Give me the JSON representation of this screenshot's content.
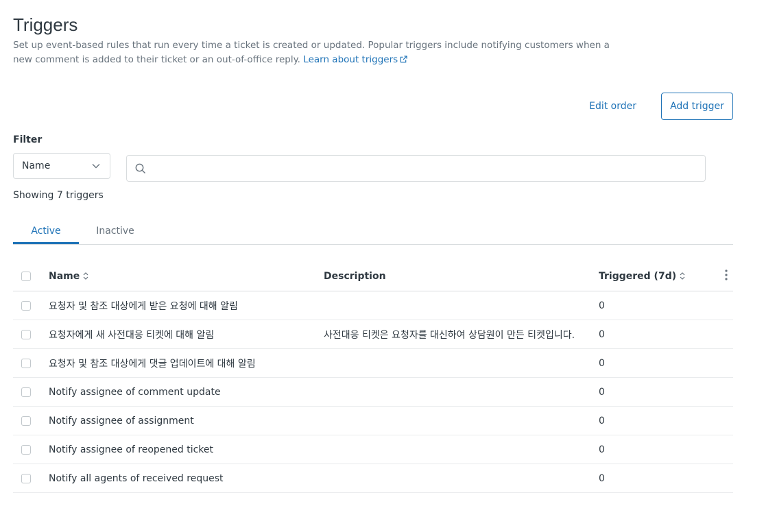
{
  "header": {
    "title": "Triggers",
    "description": "Set up event-based rules that run every time a ticket is created or updated. Popular triggers include notifying customers when a new comment is added to their ticket or an out-of-office reply.",
    "learn_link": "Learn about triggers"
  },
  "actions": {
    "edit_order": "Edit order",
    "add_trigger": "Add trigger"
  },
  "filter": {
    "label": "Filter",
    "selected": "Name",
    "search_placeholder": ""
  },
  "count_text": "Showing 7 triggers",
  "tabs": [
    {
      "label": "Active",
      "active": true
    },
    {
      "label": "Inactive",
      "active": false
    }
  ],
  "table": {
    "headers": {
      "name": "Name",
      "description": "Description",
      "triggered": "Triggered (7d)"
    },
    "rows": [
      {
        "name": "요청자 및 참조 대상에게 받은 요청에 대해 알림",
        "description": "",
        "triggered": "0"
      },
      {
        "name": "요청자에게 새 사전대응 티켓에 대해 알림",
        "description": "사전대응 티켓은 요청자를 대신하여 상담원이 만든 티켓입니다.",
        "triggered": "0"
      },
      {
        "name": "요청자 및 참조 대상에게 댓글 업데이트에 대해 알림",
        "description": "",
        "triggered": "0"
      },
      {
        "name": "Notify assignee of comment update",
        "description": "",
        "triggered": "0"
      },
      {
        "name": "Notify assignee of assignment",
        "description": "",
        "triggered": "0"
      },
      {
        "name": "Notify assignee of reopened ticket",
        "description": "",
        "triggered": "0"
      },
      {
        "name": "Notify all agents of received request",
        "description": "",
        "triggered": "0"
      }
    ]
  },
  "colors": {
    "accent": "#1f73b7",
    "text": "#2f3941",
    "muted": "#68737d",
    "border": "#d8dcde"
  },
  "icons": {
    "external_link": "external-link-icon",
    "chevron": "chevron-down-icon",
    "search": "search-icon",
    "sort": "sort-icon",
    "more": "more-vertical-icon"
  }
}
